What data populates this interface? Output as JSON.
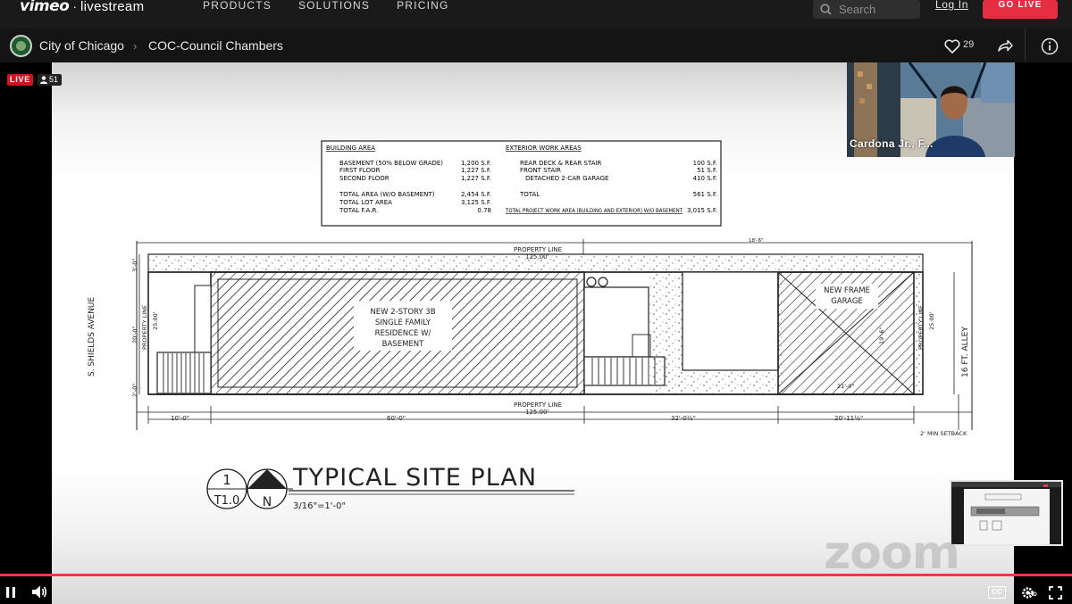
{
  "brand": {
    "logo": "vimeo",
    "separator": "·",
    "product": "livestream"
  },
  "nav": {
    "items": [
      "PRODUCTS",
      "SOLUTIONS",
      "PRICING"
    ]
  },
  "search": {
    "placeholder": "Search"
  },
  "auth": {
    "login": "Log In",
    "go_live": "GO LIVE"
  },
  "channel": {
    "name": "City of Chicago",
    "event": "COC-Council Chambers",
    "likes": "29",
    "icons": [
      "heart-icon",
      "share-icon",
      "info-icon"
    ]
  },
  "stream": {
    "live_badge": "LIVE",
    "viewers": "51",
    "speaker_name": "Cardona Jr., F...",
    "watermark": "zoom",
    "progress": 1.0,
    "accent_color": "#e53b4c"
  },
  "drawing": {
    "table_left": {
      "title": "BUILDING AREA",
      "rows": [
        {
          "label": "BASEMENT (50% BELOW GRADE)",
          "value": "1,200 S.F."
        },
        {
          "label": "FIRST FLOOR",
          "value": "1,227 S.F."
        },
        {
          "label": "SECOND FLOOR",
          "value": "1,227 S.F."
        },
        {
          "label": "TOTAL AREA (W/O BASEMENT)",
          "value": "2,454 S.F."
        },
        {
          "label": "TOTAL LOT AREA",
          "value": "3,125 S.F."
        },
        {
          "label": "TOTAL F.A.R.",
          "value": "0.78"
        }
      ]
    },
    "table_right": {
      "title": "EXTERIOR WORK AREAS",
      "rows": [
        {
          "label": "REAR DECK & REAR STAIR",
          "value": "100 S.F."
        },
        {
          "label": "FRONT STAIR",
          "value": "51 S.F."
        },
        {
          "label": "DETACHED 2-CAR GARAGE",
          "value": "410 S.F."
        },
        {
          "label": "TOTAL",
          "value": "561 S.F."
        },
        {
          "label": "TOTAL PROJECT WORK AREA (BUILDING AND EXTERIOR) W/O BASEMENT",
          "value": "3,015 S.F."
        }
      ]
    },
    "labels": {
      "street": "S. SHIELDS AVENUE",
      "alley": "16 FT. ALLEY",
      "property_line": "PROPERTY LINE",
      "lot_length": "125.00'",
      "residence_1": "NEW 2-STORY 3B",
      "residence_2": "SINGLE FAMILY",
      "residence_3": "RESIDENCE W/",
      "residence_4": "BASEMENT",
      "garage_1": "NEW FRAME",
      "garage_2": "GARAGE",
      "prop_left": "PROPERTY LINE",
      "prop_right": "PROPERTY LINE",
      "width_25": "25.00'",
      "dim_3": "3'-0\"",
      "dim_20": "20'-0\"",
      "dim_2": "2'-0\"",
      "dim_10": "10'-0\"",
      "dim_60": "60'-0\"",
      "dim_32": "32'-0½\"",
      "dim_20_11": "20'-11½\"",
      "dim_19_6": "19'-6\"",
      "dim_21": "21'-0\"",
      "setback": "2' MIN SETBACK",
      "north": "N",
      "top_mark": "18'-6\""
    },
    "title_block": {
      "sheet_num": "1",
      "sheet_ref": "T1.0",
      "title": "TYPICAL  SITE  PLAN",
      "scale": "3/16\"=1'-0\""
    }
  },
  "controls": [
    "pause-icon",
    "volume-icon",
    "captions-icon",
    "settings-icon",
    "fullscreen-icon"
  ],
  "controls_labels": {
    "cc": "CC",
    "hd": "HD"
  }
}
